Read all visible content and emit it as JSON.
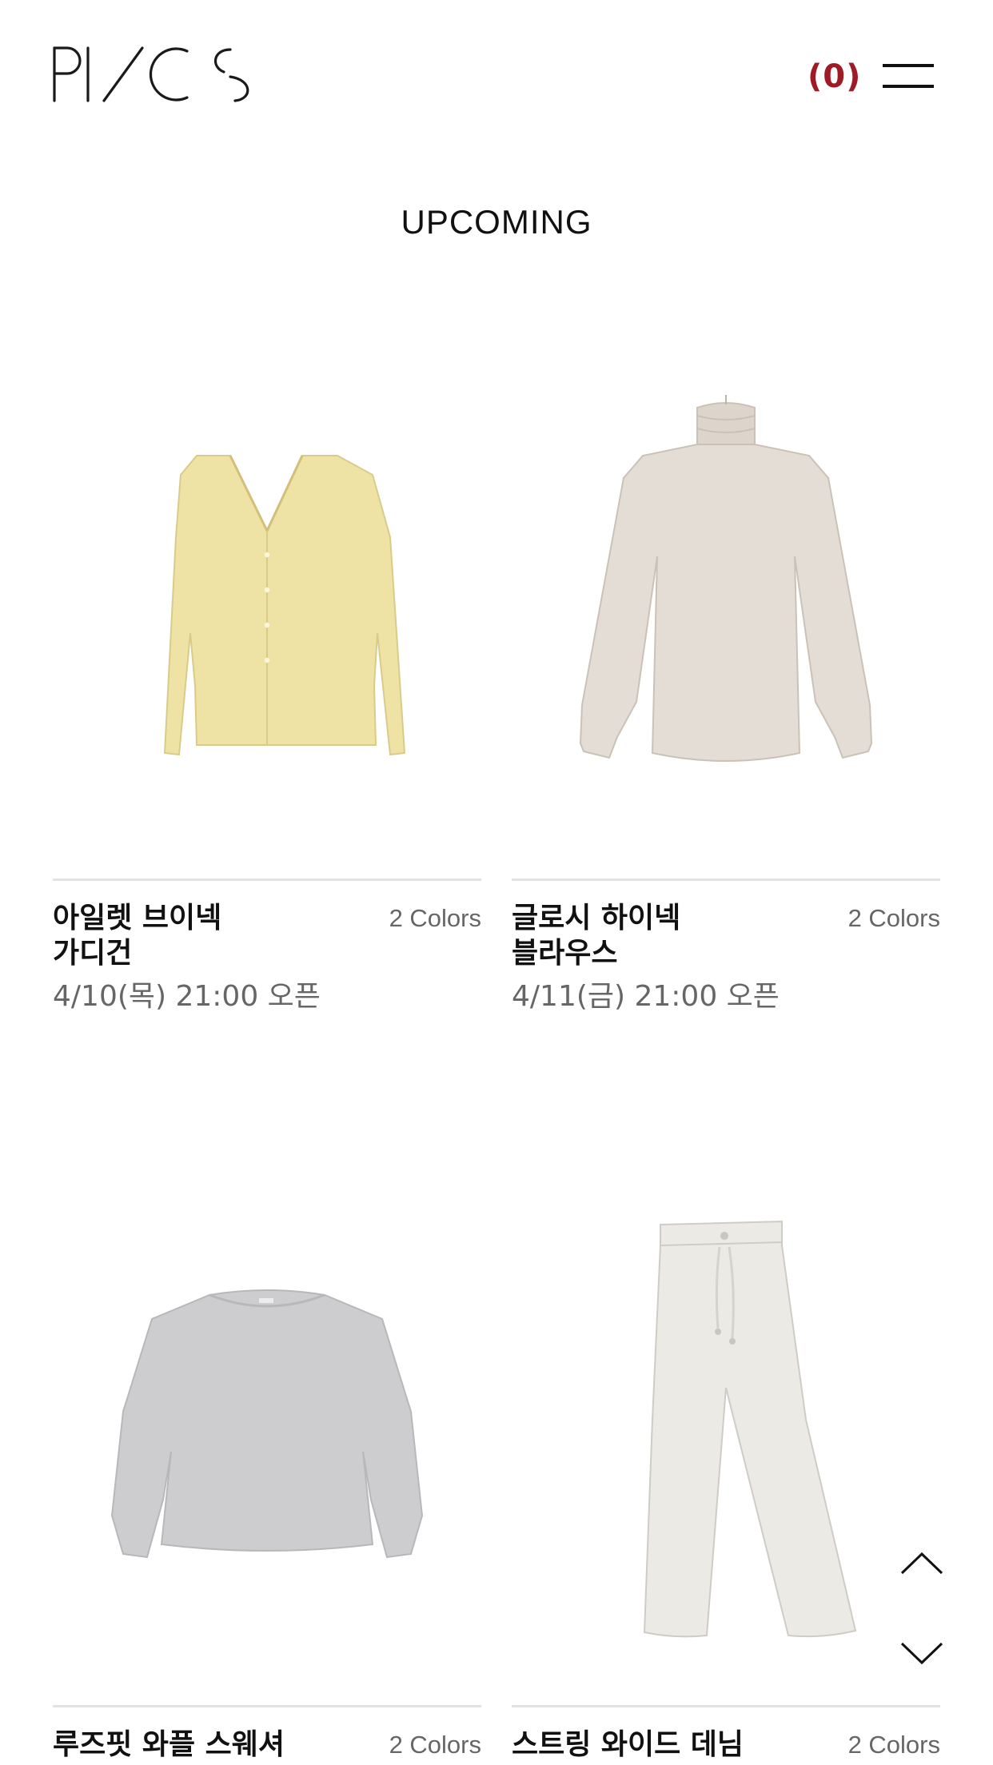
{
  "header": {
    "logo_alt": "PI/CS",
    "cart_count": "(0)"
  },
  "page_title": "UPCOMING",
  "products": [
    {
      "name": "아일렛 브이넥 가디건",
      "colors": "2 Colors",
      "open": "4/10(목) 21:00 오픈",
      "icon": "cardigan-image",
      "color": "#eee2a4"
    },
    {
      "name": "글로시 하이넥 블라우스",
      "colors": "2 Colors",
      "open": "4/11(금) 21:00 오픈",
      "icon": "blouse-image",
      "color": "#e4ddd5"
    },
    {
      "name": "루즈핏 와플 스웨셔",
      "colors": "2 Colors",
      "open": "",
      "icon": "sweatshirt-image",
      "color": "#cdcdcf"
    },
    {
      "name": "스트링 와이드 데님",
      "colors": "2 Colors",
      "open": "",
      "icon": "wide-denim-image",
      "color": "#eceae5"
    }
  ],
  "controls": {
    "scroll_up": "chevron-up-icon",
    "scroll_down": "chevron-down-icon"
  }
}
